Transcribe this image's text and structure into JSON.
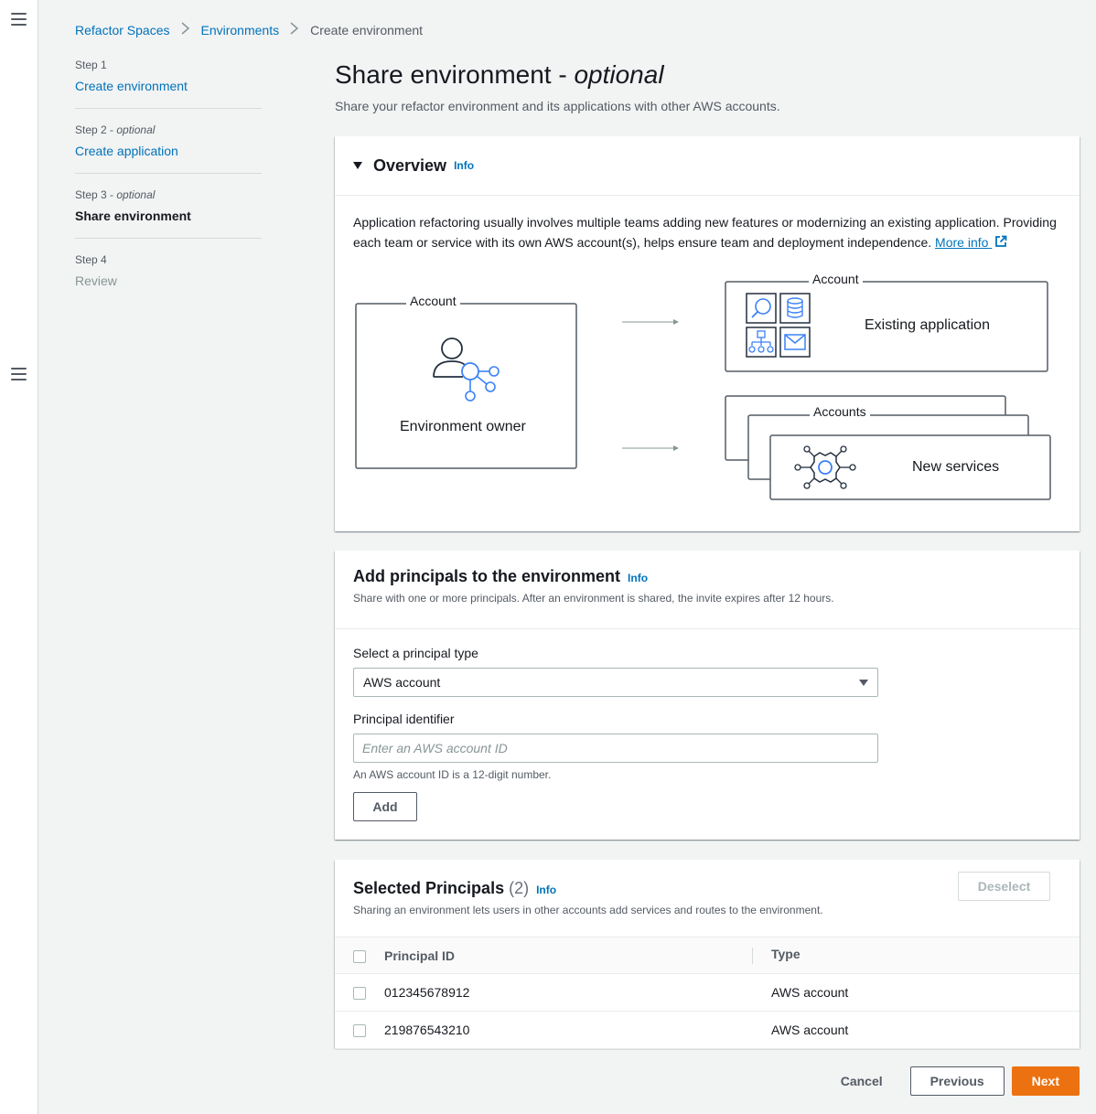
{
  "breadcrumb": {
    "items": [
      "Refactor Spaces",
      "Environments"
    ],
    "current": "Create environment"
  },
  "steps": [
    {
      "num": "Step 1",
      "optional": "",
      "label": "Create environment",
      "state": "link"
    },
    {
      "num": "Step 2",
      "optional": "optional",
      "label": "Create application",
      "state": "link"
    },
    {
      "num": "Step 3",
      "optional": "optional",
      "label": "Share environment",
      "state": "current"
    },
    {
      "num": "Step 4",
      "optional": "",
      "label": "Review",
      "state": "disabled"
    }
  ],
  "page": {
    "title": "Share environment - ",
    "title_italic": "optional",
    "description": "Share your refactor environment and its applications with other AWS accounts."
  },
  "overview": {
    "title": "Overview",
    "info": "Info",
    "body": "Application refactoring usually involves multiple teams adding new features or modernizing an existing application. Providing each team or service with its own AWS account(s), helps ensure team and deployment independence.",
    "more_info": "More info",
    "diagram": {
      "owner_account_label": "Account",
      "owner_label": "Environment owner",
      "existing_account_label": "Account",
      "existing_label": "Existing application",
      "new_accounts_label": "Accounts",
      "new_label": "New services"
    }
  },
  "add_principals": {
    "title": "Add principals to the environment",
    "info": "Info",
    "subtitle": "Share with one or more principals. After an environment is shared, the invite expires after 12 hours.",
    "type_label": "Select a principal type",
    "type_value": "AWS account",
    "id_label": "Principal identifier",
    "id_placeholder": "Enter an AWS account ID",
    "id_constraint": "An AWS account ID is a 12-digit number.",
    "add_button": "Add"
  },
  "selected_principals": {
    "title": "Selected Principals",
    "count": "(2)",
    "info": "Info",
    "subtitle": "Sharing an environment lets users in other accounts add services and routes to the environment.",
    "deselect_button": "Deselect",
    "columns": [
      "Principal ID",
      "Type"
    ],
    "rows": [
      {
        "id": "012345678912",
        "type": "AWS account"
      },
      {
        "id": "219876543210",
        "type": "AWS account"
      }
    ]
  },
  "footer": {
    "cancel": "Cancel",
    "previous": "Previous",
    "next": "Next"
  },
  "colors": {
    "accent": "#0073bb",
    "primary_button": "#ec7211",
    "diagram_icon": "#3b82f6"
  }
}
